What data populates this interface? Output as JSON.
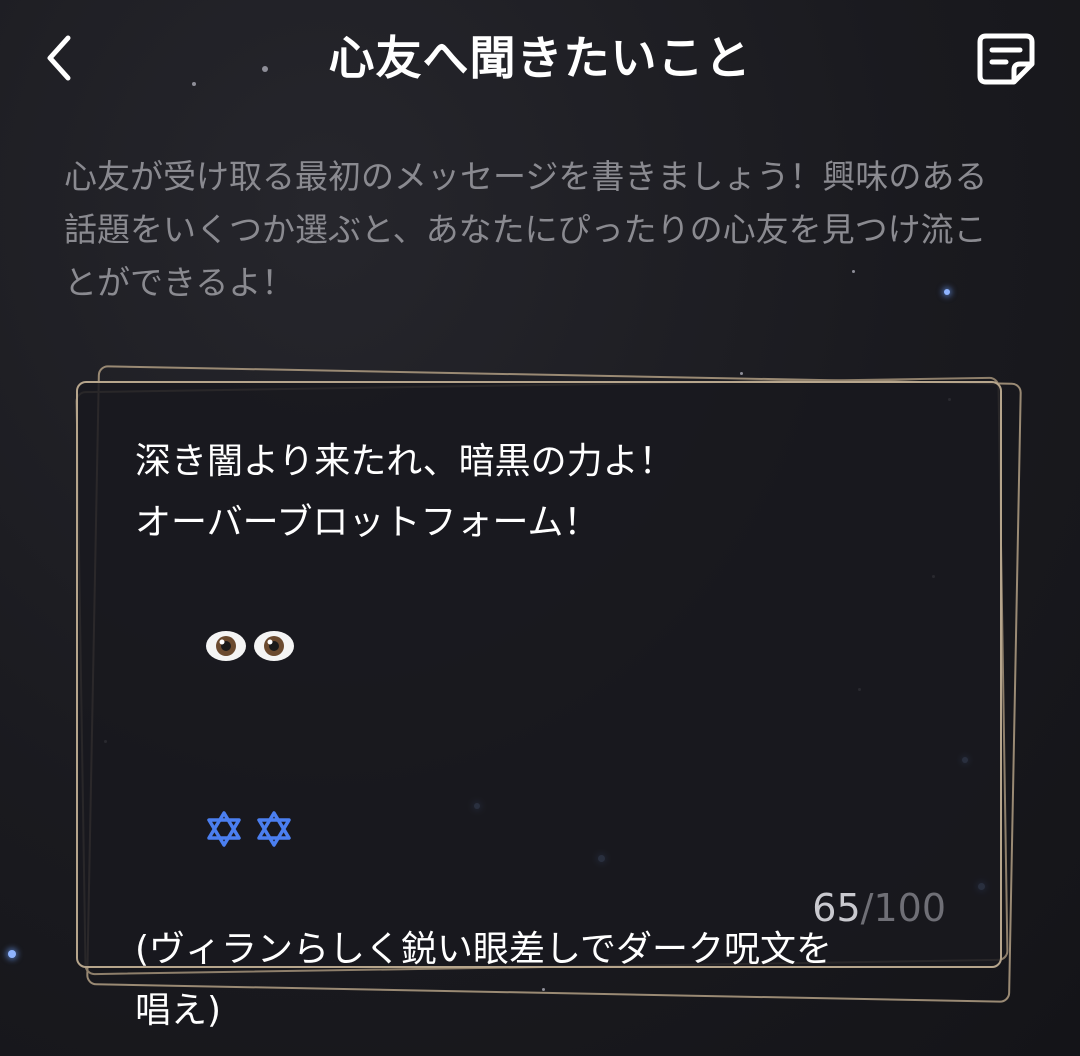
{
  "header": {
    "title": "心友へ聞きたいこと"
  },
  "description": "心友が受け取る最初のメッセージを書きましょう！興味のある話題をいくつか選ぶと、あなたにぴったりの心友を見つけ流ことができるよ！",
  "message": {
    "line1": "深き闇より来たれ、暗黒の力よ！",
    "line2": "オーバーブロットフォーム！",
    "line3_emoji": "eyes-emoji x2",
    "line4_emoji": "star-of-david-emoji x2",
    "line5": "(ヴィランらしく鋭い眼差しでダーク呪文を",
    "line6": "唱え)"
  },
  "counter": {
    "current": "65",
    "separator": "/",
    "max": "100"
  },
  "colors": {
    "background": "#1a1a1f",
    "card_border": "#b6a58c",
    "text": "#ffffff",
    "muted_text": "#8a8a90",
    "star_blue": "#8fb4ff"
  },
  "icons": {
    "back": "chevron-left-icon",
    "note": "note-icon"
  }
}
